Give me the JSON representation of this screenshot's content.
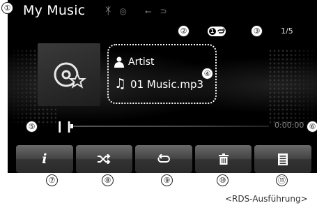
{
  "header": {
    "title": "My Music",
    "track_count": "1/5",
    "repeat_badge_num": "1"
  },
  "now_playing": {
    "artist": "Artist",
    "file_name": "01 Music.mp3",
    "elapsed": "0:00:00",
    "progress": 0.0
  },
  "toolbar": {
    "buttons": [
      {
        "name": "info",
        "icon": "info-icon"
      },
      {
        "name": "shuffle",
        "icon": "shuffle-icon"
      },
      {
        "name": "repeat",
        "icon": "repeat-icon"
      },
      {
        "name": "delete",
        "icon": "trash-icon"
      },
      {
        "name": "list",
        "icon": "list-icon"
      }
    ]
  },
  "callouts": [
    "①",
    "②",
    "③",
    "④",
    "⑤",
    "⑥",
    "⑦",
    "⑧",
    "⑨",
    "⑩",
    "⑪"
  ],
  "caption": "<RDS-Ausführung>",
  "colors": {
    "screen_bg": "#000000",
    "text": "#ffffff",
    "button": "#444444"
  }
}
